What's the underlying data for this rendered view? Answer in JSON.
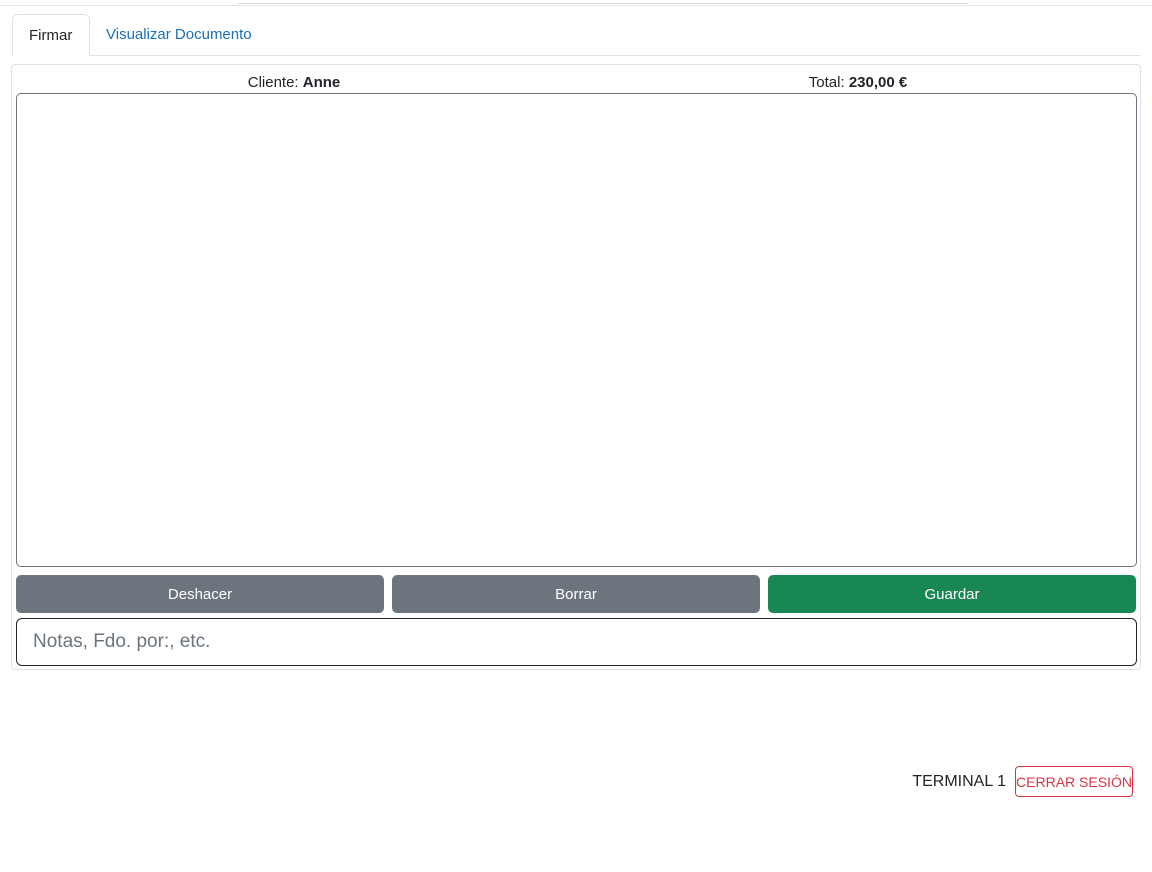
{
  "tabs": [
    {
      "label": "Firmar",
      "active": true
    },
    {
      "label": "Visualizar Documento",
      "active": false
    }
  ],
  "info": {
    "client_label": "Cliente:",
    "client_name": "Anne",
    "total_label": "Total:",
    "total_value": "230,00 €"
  },
  "actions": {
    "undo_label": "Deshacer",
    "clear_label": "Borrar",
    "save_label": "Guardar"
  },
  "notes": {
    "value": "",
    "placeholder": "Notas, Fdo. por:, etc."
  },
  "footer": {
    "terminal_label": "TERMINAL 1",
    "logout_label": "CERRAR SESIÓN"
  },
  "colors": {
    "secondary": "#6c757d",
    "success": "#198754",
    "danger": "#dc3545",
    "link": "#1a6fb8"
  }
}
